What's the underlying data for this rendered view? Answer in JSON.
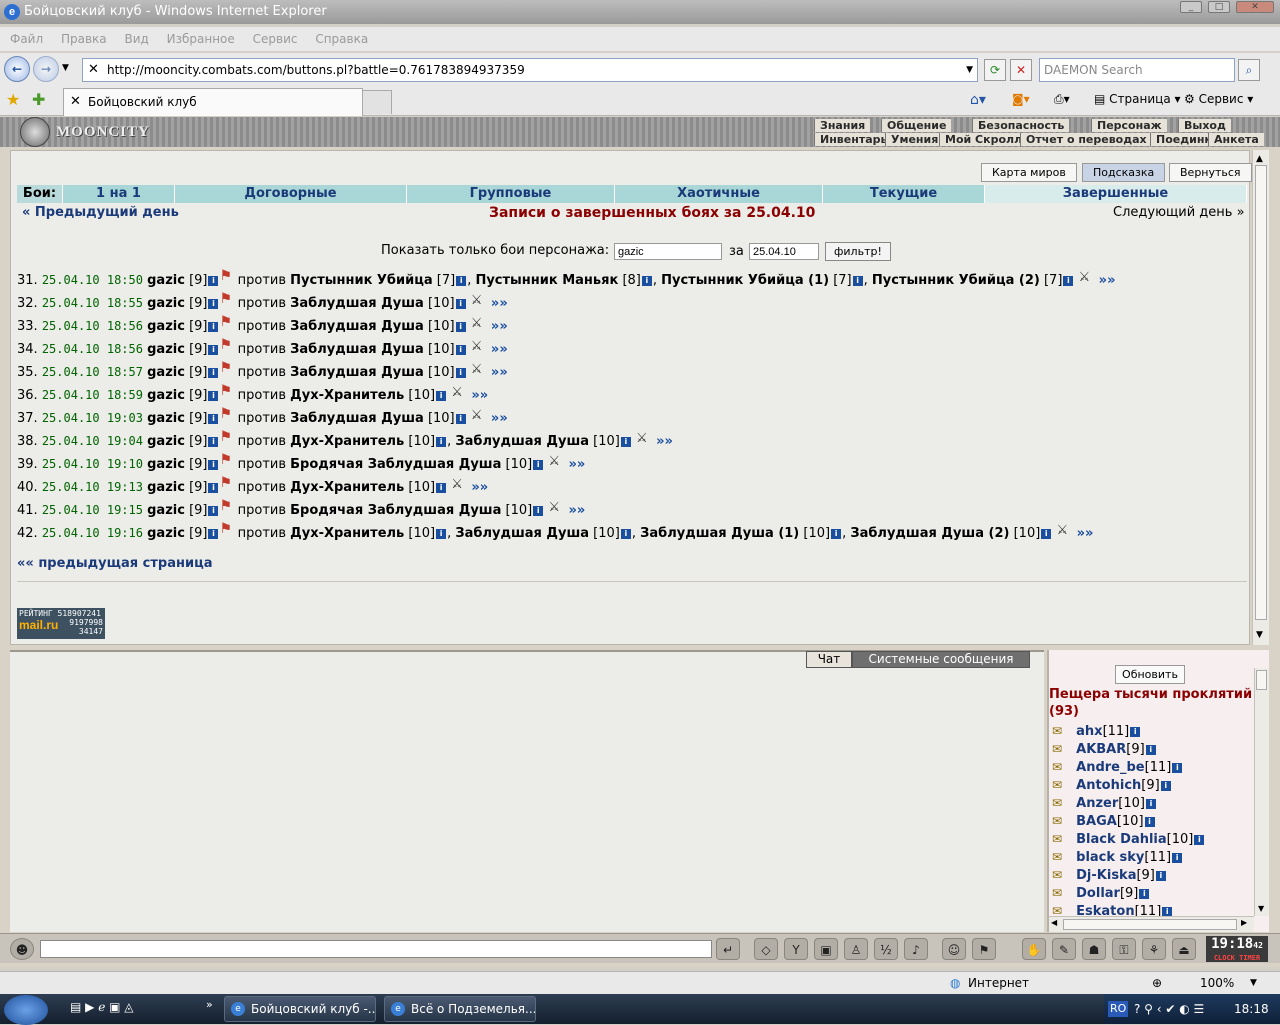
{
  "window": {
    "title": "Бойцовский клуб - Windows Internet Explorer"
  },
  "menubar": [
    "Файл",
    "Правка",
    "Вид",
    "Избранное",
    "Сервис",
    "Справка"
  ],
  "address": {
    "url": "http://mooncity.combats.com/buttons.pl?battle=0.761783894937359",
    "search_placeholder": "DAEMON Search"
  },
  "tab": {
    "title": "Бойцовский клуб"
  },
  "toolbar": {
    "page": "Страница",
    "tools": "Сервис"
  },
  "game": {
    "logo": "MOONCITY",
    "top_menu": [
      "Знания",
      "Общение",
      "Безопасность",
      "Персонаж",
      "Выход"
    ],
    "sub_menu": [
      "Инвентарь",
      "Умения",
      "Мой Скролл",
      "Отчет о переводах",
      "Поединки",
      "Анкета"
    ],
    "buttons": {
      "map": "Карта миров",
      "hint": "Подсказка",
      "back": "Вернуться"
    },
    "battle_label": "Бои:",
    "battle_tabs": [
      "1 на 1",
      "Договорные",
      "Групповые",
      "Хаотичные",
      "Текущие",
      "Завершенные"
    ],
    "prev_day": "« Предыдущий день",
    "next_day": "Следующий день »",
    "records_title": "Записи о завершенных боях за 25.04.10",
    "filter": {
      "label": "Показать только бои персонажа:",
      "name": "gazic",
      "date_label": "за",
      "date": "25.04.10",
      "button": "фильтр!"
    },
    "prev_page": "«« предыдущая страница",
    "counter": {
      "title": "РЕЙТИНГ",
      "line1": "518907241",
      "line2": "9197998",
      "line3": "34147",
      "brand": "mail.ru"
    }
  },
  "battles": [
    {
      "n": "31.",
      "dt": "25.04.10 18:50",
      "p": "gazic",
      "pl": "[9]",
      "opp": "<b>Пустынник Убийца</b> [7], <b>Пустынник Маньяк</b> [8], <b>Пустынник Убийца (1)</b> [7], <b>Пустынник Убийца (2)</b> [7]"
    },
    {
      "n": "32.",
      "dt": "25.04.10 18:55",
      "p": "gazic",
      "pl": "[9]",
      "opp": "<b>Заблудшая Душа</b> [10]"
    },
    {
      "n": "33.",
      "dt": "25.04.10 18:56",
      "p": "gazic",
      "pl": "[9]",
      "opp": "<b>Заблудшая Душа</b> [10]"
    },
    {
      "n": "34.",
      "dt": "25.04.10 18:56",
      "p": "gazic",
      "pl": "[9]",
      "opp": "<b>Заблудшая Душа</b> [10]"
    },
    {
      "n": "35.",
      "dt": "25.04.10 18:57",
      "p": "gazic",
      "pl": "[9]",
      "opp": "<b>Заблудшая Душа</b> [10]"
    },
    {
      "n": "36.",
      "dt": "25.04.10 18:59",
      "p": "gazic",
      "pl": "[9]",
      "opp": "<b>Дух-Хранитель</b> [10]"
    },
    {
      "n": "37.",
      "dt": "25.04.10 19:03",
      "p": "gazic",
      "pl": "[9]",
      "opp": "<b>Заблудшая Душа</b> [10]"
    },
    {
      "n": "38.",
      "dt": "25.04.10 19:04",
      "p": "gazic",
      "pl": "[9]",
      "opp": "<b>Дух-Хранитель</b> [10], <b>Заблудшая Душа</b> [10]"
    },
    {
      "n": "39.",
      "dt": "25.04.10 19:10",
      "p": "gazic",
      "pl": "[9]",
      "opp": "<b>Бродячая Заблудшая Душа</b> [10]"
    },
    {
      "n": "40.",
      "dt": "25.04.10 19:13",
      "p": "gazic",
      "pl": "[9]",
      "opp": "<b>Дух-Хранитель</b> [10]"
    },
    {
      "n": "41.",
      "dt": "25.04.10 19:15",
      "p": "gazic",
      "pl": "[9]",
      "opp": "<b>Бродячая Заблудшая Душа</b> [10]"
    },
    {
      "n": "42.",
      "dt": "25.04.10 19:16",
      "p": "gazic",
      "pl": "[9]",
      "opp": "<b>Дух-Хранитель</b> [10], <b>Заблудшая Душа</b> [10], <b>Заблудшая Душа (1)</b> [10], <b>Заблудшая Душа (2)</b> [10]"
    }
  ],
  "vs": "против",
  "chat": {
    "tab_chat": "Чат",
    "tab_system": "Системные сообщения",
    "refresh": "Обновить",
    "location": "Пещера тысячи проклятий (93)"
  },
  "users": [
    {
      "name": "ahx",
      "lvl": "[11]"
    },
    {
      "name": "AKBAR",
      "lvl": "[9]"
    },
    {
      "name": "Andre_be",
      "lvl": "[11]"
    },
    {
      "name": "Antohich",
      "lvl": "[9]"
    },
    {
      "name": "Anzer",
      "lvl": "[10]"
    },
    {
      "name": "BAGA",
      "lvl": "[10]"
    },
    {
      "name": "Black Dahlia",
      "lvl": "[10]"
    },
    {
      "name": "black sky",
      "lvl": "[11]"
    },
    {
      "name": "Dj-Kiska",
      "lvl": "[9]"
    },
    {
      "name": "Dollar",
      "lvl": "[9]"
    },
    {
      "name": "Eskaton",
      "lvl": "[11]"
    }
  ],
  "clock": {
    "time": "19:18",
    "sec": "42",
    "label": "CLOCK TIMER"
  },
  "status": {
    "zone": "Интернет",
    "zoom": "100%"
  },
  "taskbar": {
    "task1": "Бойцовский клуб -...",
    "task2": "Всё о Подземелья...",
    "lang": "RO",
    "time": "18:18"
  }
}
